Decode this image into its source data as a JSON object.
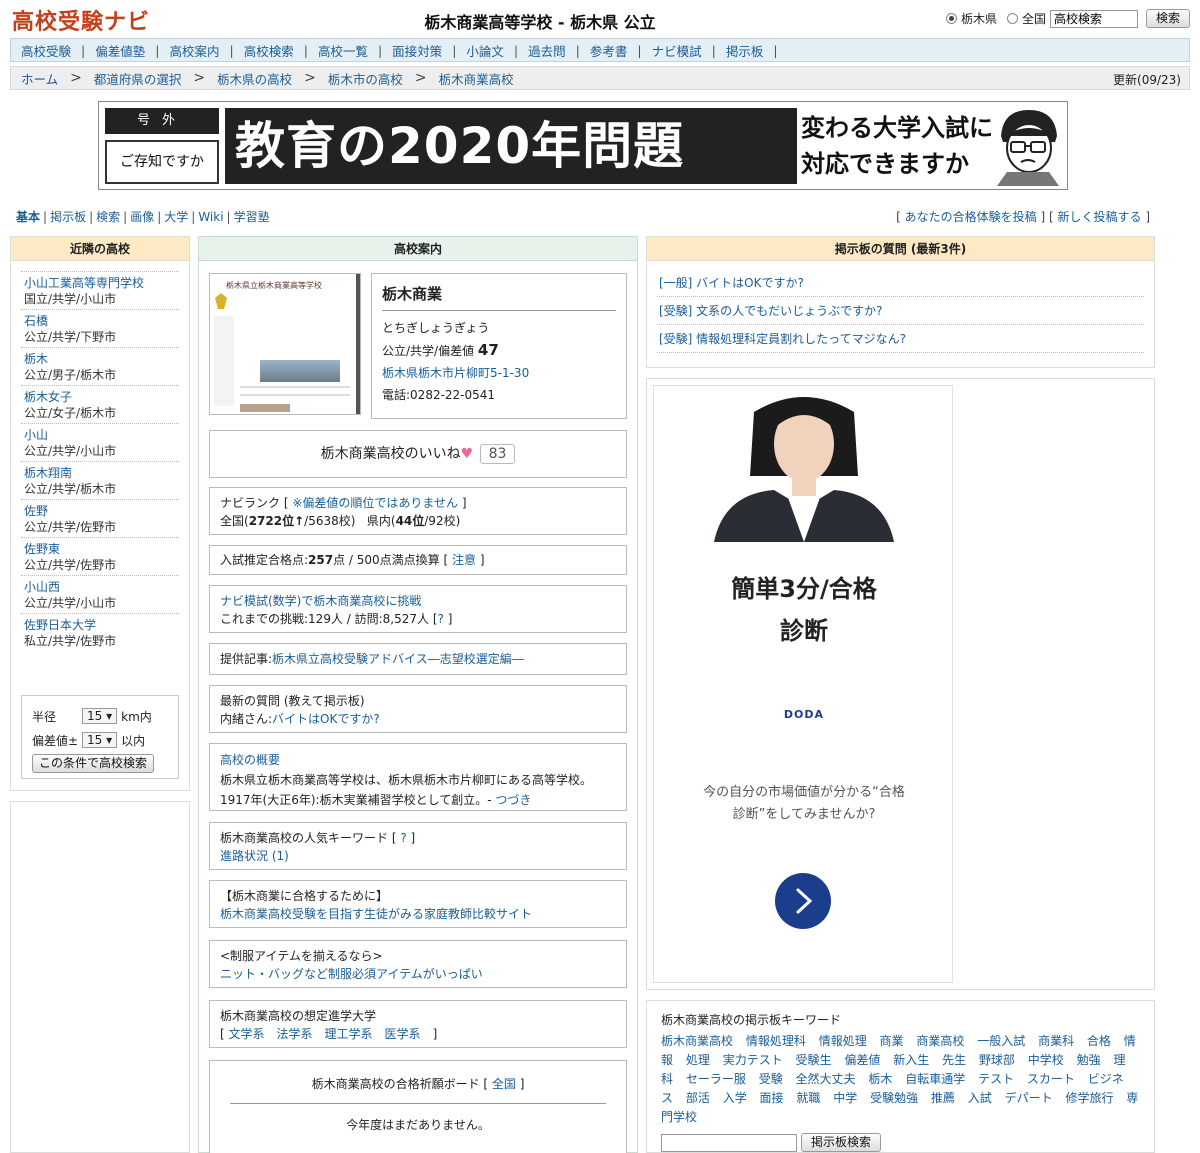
{
  "header": {
    "logo": "高校受験ナビ",
    "title": "栃木商業高等学校 - 栃木県 公立",
    "radio_pref": "栃木県",
    "radio_all": "全国",
    "search_value": "高校検索",
    "search_button": "検索"
  },
  "topnav": [
    "高校受験",
    "偏差値塾",
    "高校案内",
    "高校検索",
    "高校一覧",
    "面接対策",
    "小論文",
    "過去問",
    "参考書",
    "ナビ模試",
    "掲示板"
  ],
  "breadcrumb": {
    "items": [
      "ホーム",
      "都道府県の選択",
      "栃木県の高校",
      "栃木市の高校",
      "栃木商業高校"
    ],
    "update": "更新(09/23)"
  },
  "banner": {
    "gogai": "号外",
    "know": "ご存知ですか",
    "main": "教育の2020年問題",
    "side_line1": "変わる大学入試に",
    "side_line2": "対応できますか"
  },
  "subnav": {
    "items": [
      "基本",
      "掲示板",
      "検索",
      "画像",
      "大学",
      "Wiki",
      "学習塾"
    ],
    "post_experience": "あなたの合格体験を投稿",
    "new_post": "新しく投稿する"
  },
  "left": {
    "title": "近隣の高校",
    "schools": [
      {
        "name": "小山工業高等専門学校",
        "meta": "国立/共学/小山市"
      },
      {
        "name": "石橋",
        "meta": "公立/共学/下野市"
      },
      {
        "name": "栃木",
        "meta": "公立/男子/栃木市"
      },
      {
        "name": "栃木女子",
        "meta": "公立/女子/栃木市"
      },
      {
        "name": "小山",
        "meta": "公立/共学/小山市"
      },
      {
        "name": "栃木翔南",
        "meta": "公立/共学/栃木市"
      },
      {
        "name": "佐野",
        "meta": "公立/共学/佐野市"
      },
      {
        "name": "佐野東",
        "meta": "公立/共学/佐野市"
      },
      {
        "name": "小山西",
        "meta": "公立/共学/小山市"
      },
      {
        "name": "佐野日本大学",
        "meta": "私立/共学/佐野市"
      }
    ],
    "filter": {
      "radius_label": "半径",
      "radius_value": "15",
      "radius_unit": "km内",
      "dev_label": "偏差値±",
      "dev_value": "15",
      "dev_unit": "以内",
      "button": "この条件で高校検索"
    }
  },
  "center": {
    "title": "高校案内",
    "school": {
      "name": "栃木商業",
      "kana": "とちぎしょうぎょう",
      "type": "公立/共学/偏差値",
      "hensachi": "47",
      "address": "栃木県栃木市片柳町5-1-30",
      "phone": "電話:0282-22-0541"
    },
    "thumb": {
      "heading": "栃木県立栃木商業高等学校"
    },
    "like": {
      "label": "栃木商業高校のいいね",
      "count": "83"
    },
    "rank": {
      "label": "ナビランク",
      "note": "※偏差値の順位ではありません",
      "national": "全国(",
      "national_rank": "2722位↑",
      "national_total": "/5638校)",
      "pref": "県内(",
      "pref_rank": "44位",
      "pref_total": "/92校)"
    },
    "score": {
      "prefix": "入試推定合格点:",
      "value": "257",
      "suffix": "点 / 500点満点換算 [",
      "link": "注意"
    },
    "mock": {
      "link": "ナビ模試(数学)で栃木商業高校に挑戦",
      "stats": "これまでの挑戦:129人 / 訪問:8,527人 [",
      "q": "?"
    },
    "article": {
      "label": "提供記事:",
      "link": "栃木県立高校受験アドバイス―志望校選定編―"
    },
    "latest": {
      "label": "最新の質問 (教えて掲示板)",
      "who": "内緒さん:",
      "link": "バイトはOKですか?"
    },
    "overview": {
      "link": "高校の概要",
      "line1": "栃木県立栃木商業高等学校は、栃木県栃木市片柳町にある高等学校。",
      "line2": "1917年(大正6年):栃木実業補習学校として創立。-",
      "more": "つづき"
    },
    "keywords": {
      "label": "栃木商業高校の人気キーワード [",
      "q": "?",
      "link": "進路状況 (1)"
    },
    "pass": {
      "label": "【栃木商業に合格するために】",
      "link": "栃木商業高校受験を目指す生徒がみる家庭教師比較サイト"
    },
    "uniform": {
      "label": "<制服アイテムを揃えるなら>",
      "link": "ニット・バッグなど制服必須アイテムがいっぱい"
    },
    "univ": {
      "label": "栃木商業高校の想定進学大学",
      "items": [
        "文学系",
        "法学系",
        "理工学系",
        "医学系"
      ]
    },
    "board": {
      "label": "栃木商業高校の合格祈願ボード [",
      "link": "全国",
      "empty": "今年度はまだありません。"
    }
  },
  "right": {
    "questions_title": "掲示板の質問 (最新3件)",
    "questions": [
      "[一般] バイトはOKですか?",
      "[受験] 文系の人でもだいじょうぶですか?",
      "[受験] 情報処理科定員割れしたってマジなん?"
    ],
    "ad": {
      "headline1": "簡単3分/合格",
      "headline2": "診断",
      "brand": "DODA",
      "text1": "今の自分の市場価値が分かる“合格",
      "text2": "診断”をしてみませんか?"
    },
    "kw_title": "栃木商業高校の掲示板キーワード",
    "kw": [
      "栃木商業高校",
      "情報処理科",
      "情報処理",
      "商業",
      "商業高校",
      "一般入試",
      "商業科",
      "合格",
      "情報",
      "処理",
      "実力テスト",
      "受験生",
      "偏差値",
      "新入生",
      "先生",
      "野球部",
      "中学校",
      "勉強",
      "理科",
      "セーラー服",
      "受験",
      "全然大丈夫",
      "栃木",
      "自転車通学",
      "テスト",
      "スカート",
      "ビジネス",
      "部活",
      "入学",
      "面接",
      "就職",
      "中学",
      "受験勉強",
      "推薦",
      "入試",
      "デパート",
      "修学旅行",
      "専門学校"
    ],
    "kw_search_button": "掲示板検索"
  }
}
